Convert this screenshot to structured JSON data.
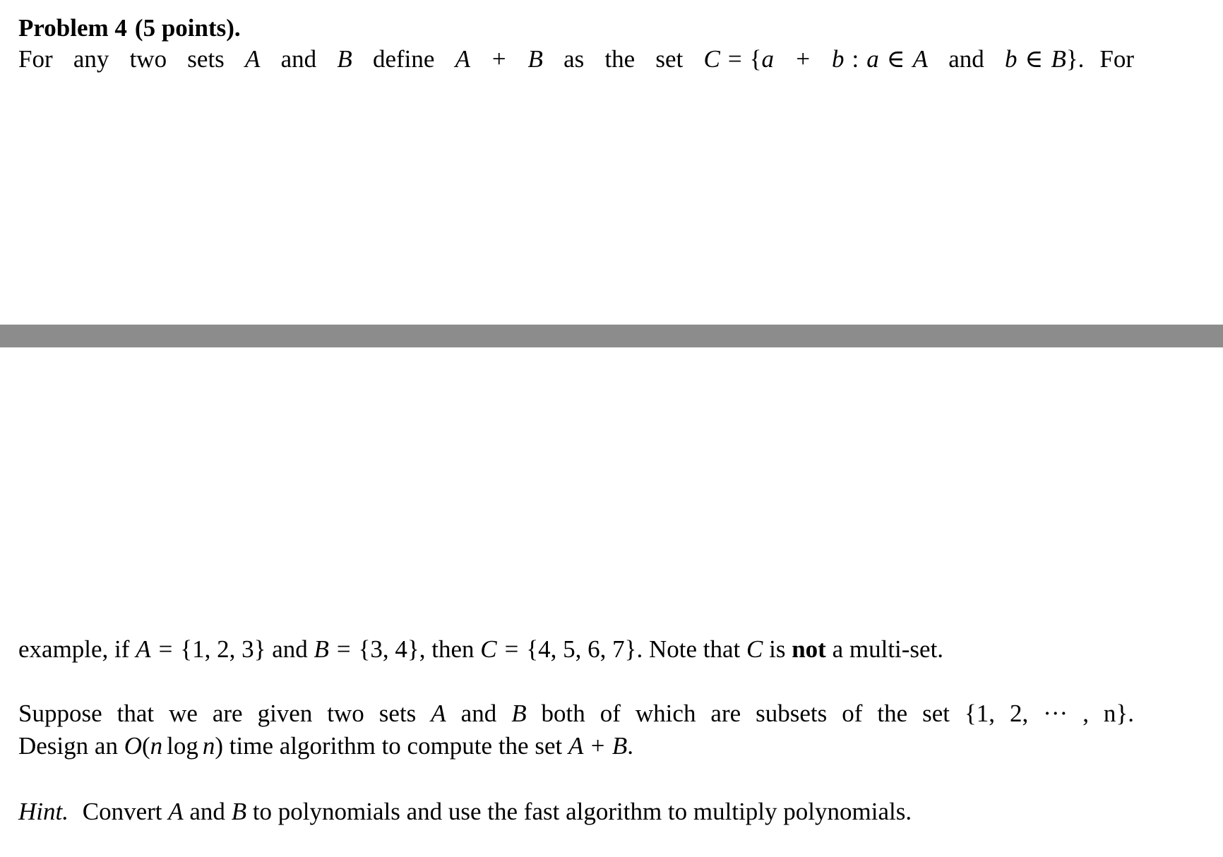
{
  "document": {
    "problem_heading": {
      "label": "Problem 4",
      "points": "(5 points)."
    },
    "paragraph_intro": {
      "t1": "For any two sets ",
      "var_A": "A",
      "t2": " and ",
      "var_B": "B",
      "t3": " define ",
      "expr_sum": "A + B",
      "t4": " as the set ",
      "var_C": "C",
      "eq": "=",
      "set_open": "{",
      "expr_ab": "a + b",
      "colon": ":",
      "elem_a": "a",
      "in1": "∈",
      "elem_A": "A",
      "t5": " and ",
      "elem_b": "b",
      "in2": "∈",
      "elem_B": "B",
      "set_close": "}",
      "period": ".",
      "t6": "For"
    },
    "paragraph_example": {
      "t1": "example, if ",
      "var_A": "A",
      "eq1": "=",
      "set_A": "{1, 2, 3}",
      "t2": " and ",
      "var_B": "B",
      "eq2": "=",
      "set_B": "{3, 4}",
      "t3": ", then ",
      "var_C": "C",
      "eq3": "=",
      "set_C": "{4, 5, 6, 7}",
      "t4": ". Note that ",
      "var_C2": "C",
      "t5": " is ",
      "bold_not": "not",
      "t6": " a multi-set."
    },
    "paragraph_suppose": {
      "line1_t1": "Suppose that we are given two sets ",
      "line1_A": "A",
      "line1_t2": " and ",
      "line1_B": "B",
      "line1_t3": " both of which are subsets of the set ",
      "line1_set": "{1, 2, ··· , n}",
      "line1_period": ".",
      "line2_t1": "Design an ",
      "line2_O": "O",
      "line2_paren_open": "(",
      "line2_n1": "n",
      "line2_log": "log",
      "line2_n2": "n",
      "line2_paren_close": ")",
      "line2_t2": " time algorithm to compute the set ",
      "line2_expr": "A + B",
      "line2_period": "."
    },
    "paragraph_hint": {
      "hint_label": "Hint.",
      "t1": " Convert ",
      "var_A": "A",
      "t2": " and ",
      "var_B": "B",
      "t3": " to polynomials and use the fast algorithm to multiply polynomials."
    }
  },
  "separator": {
    "color": "#8c8c8c"
  }
}
